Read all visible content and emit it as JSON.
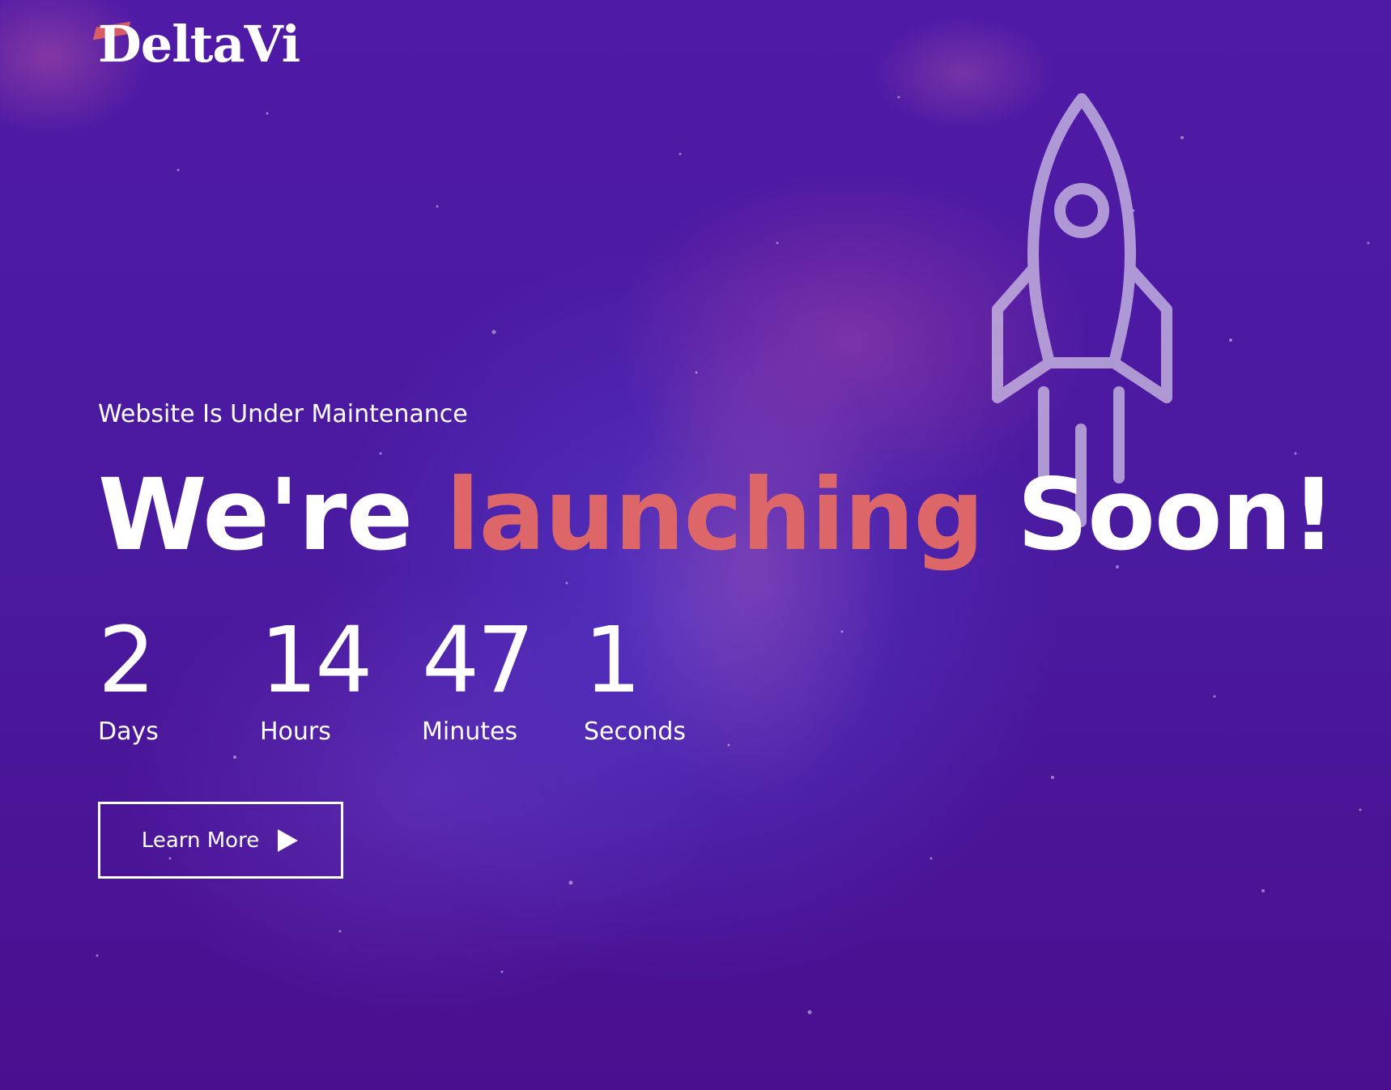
{
  "brand": {
    "logo_text": "DeltaVi"
  },
  "hero": {
    "subtitle": "Website Is Under Maintenance",
    "headline_part1": "We're ",
    "headline_accent": "launching",
    "headline_part2": " Soon!",
    "accent_color": "#dd6768"
  },
  "countdown": [
    {
      "value": "2",
      "label": "Days"
    },
    {
      "value": "14",
      "label": "Hours"
    },
    {
      "value": "47",
      "label": "Minutes"
    },
    {
      "value": "1",
      "label": "Seconds"
    }
  ],
  "cta": {
    "label": "Learn More",
    "icon": "play-icon"
  },
  "colors": {
    "background": "#4a1a9f",
    "text": "#ffffff",
    "accent": "#dd6768"
  },
  "decor": {
    "illustration": "rocket-icon"
  }
}
